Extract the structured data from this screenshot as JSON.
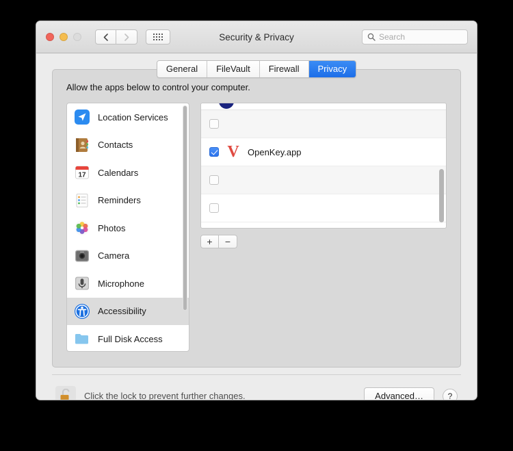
{
  "window": {
    "title": "Security & Privacy",
    "traffic_lights": [
      "close",
      "minimize",
      "zoom"
    ],
    "nav": {
      "back": "‹",
      "forward": "›",
      "grid_icon": "grid-icon"
    },
    "search": {
      "placeholder": "Search",
      "value": "",
      "icon": "search-icon"
    }
  },
  "tabs": [
    {
      "label": "General",
      "active": false
    },
    {
      "label": "FileVault",
      "active": false
    },
    {
      "label": "Firewall",
      "active": false
    },
    {
      "label": "Privacy",
      "active": true
    }
  ],
  "sidebar": {
    "items": [
      {
        "label": "Location Services",
        "icon": "location-arrow-icon",
        "selected": false
      },
      {
        "label": "Contacts",
        "icon": "contacts-book-icon",
        "selected": false
      },
      {
        "label": "Calendars",
        "icon": "calendar-icon",
        "selected": false,
        "icon_day": "17"
      },
      {
        "label": "Reminders",
        "icon": "reminders-list-icon",
        "selected": false
      },
      {
        "label": "Photos",
        "icon": "photos-flower-icon",
        "selected": false
      },
      {
        "label": "Camera",
        "icon": "camera-icon",
        "selected": false
      },
      {
        "label": "Microphone",
        "icon": "microphone-icon",
        "selected": false
      },
      {
        "label": "Accessibility",
        "icon": "accessibility-icon",
        "selected": true
      },
      {
        "label": "Full Disk Access",
        "icon": "folder-icon",
        "selected": false
      }
    ]
  },
  "main": {
    "description": "Allow the apps below to control your computer.",
    "app_rows": [
      {
        "name": "",
        "checked": false,
        "partial": true,
        "icon": "partial-blue-icon"
      },
      {
        "name": "",
        "checked": false,
        "partial": false,
        "icon": ""
      },
      {
        "name": "OpenKey.app",
        "checked": true,
        "partial": false,
        "icon": "openkey-v-icon",
        "icon_glyph": "V"
      },
      {
        "name": "",
        "checked": false,
        "partial": false,
        "icon": ""
      },
      {
        "name": "",
        "checked": false,
        "partial": false,
        "icon": ""
      }
    ],
    "add_label": "+",
    "remove_label": "−"
  },
  "bottom": {
    "lock_icon": "unlocked-padlock-icon",
    "lock_text": "Click the lock to prevent further changes.",
    "advanced_label": "Advanced…",
    "help_label": "?"
  },
  "colors": {
    "accent_blue": "#2c74ee",
    "tab_active": "#1d6ee8",
    "app_icon_red": "#e04a41",
    "window_bg": "#ececec",
    "panel_bg": "#d9d9d9"
  }
}
